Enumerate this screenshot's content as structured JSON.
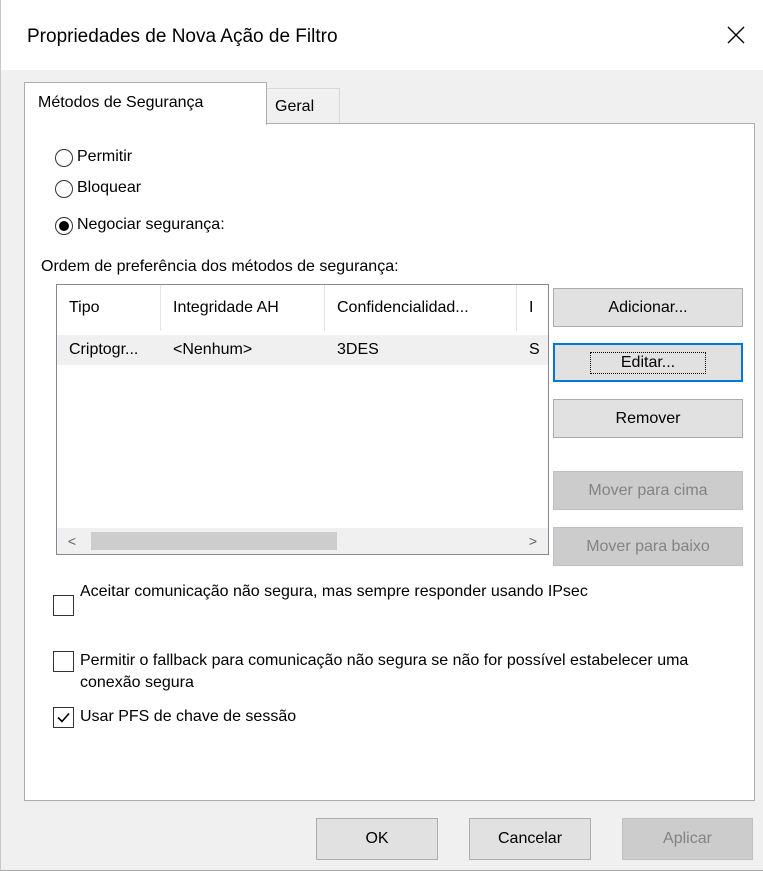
{
  "window": {
    "title": "Propriedades de Nova Ação de Filtro",
    "close_icon": "close-icon"
  },
  "tabs": [
    {
      "label": "Métodos de Segurança",
      "active": true
    },
    {
      "label": "Geral",
      "active": false
    }
  ],
  "action": {
    "options": [
      {
        "label": "Permitir",
        "checked": false
      },
      {
        "label": "Bloquear",
        "checked": false
      },
      {
        "label": "Negociar segurança:",
        "checked": true
      }
    ]
  },
  "methods": {
    "label": "Ordem de preferência dos métodos de segurança:",
    "columns": [
      "Tipo",
      "Integridade AH",
      "Confidencialidad...",
      "I"
    ],
    "rows": [
      [
        "Criptogr...",
        "<Nenhum>",
        "3DES",
        "S"
      ]
    ],
    "scroll_left": "<",
    "scroll_right": ">"
  },
  "buttons": {
    "add": "Adicionar...",
    "edit": "Editar...",
    "remove": "Remover",
    "move_up": "Mover para cima",
    "move_down": "Mover para baixo"
  },
  "checkboxes": [
    {
      "label": "Aceitar comunicação não segura, mas sempre responder usando IPsec",
      "checked": false
    },
    {
      "label": "Permitir o fallback para comunicação não segura se não for possível estabelecer uma conexão segura",
      "checked": false
    },
    {
      "label": "Usar PFS de chave de sessão",
      "checked": true
    }
  ],
  "footer": {
    "ok": "OK",
    "cancel": "Cancelar",
    "apply": "Aplicar"
  },
  "colors": {
    "focus_border": "#0078d7",
    "dialog_bg": "#f0f0f0",
    "panel_bg": "#ffffff"
  }
}
